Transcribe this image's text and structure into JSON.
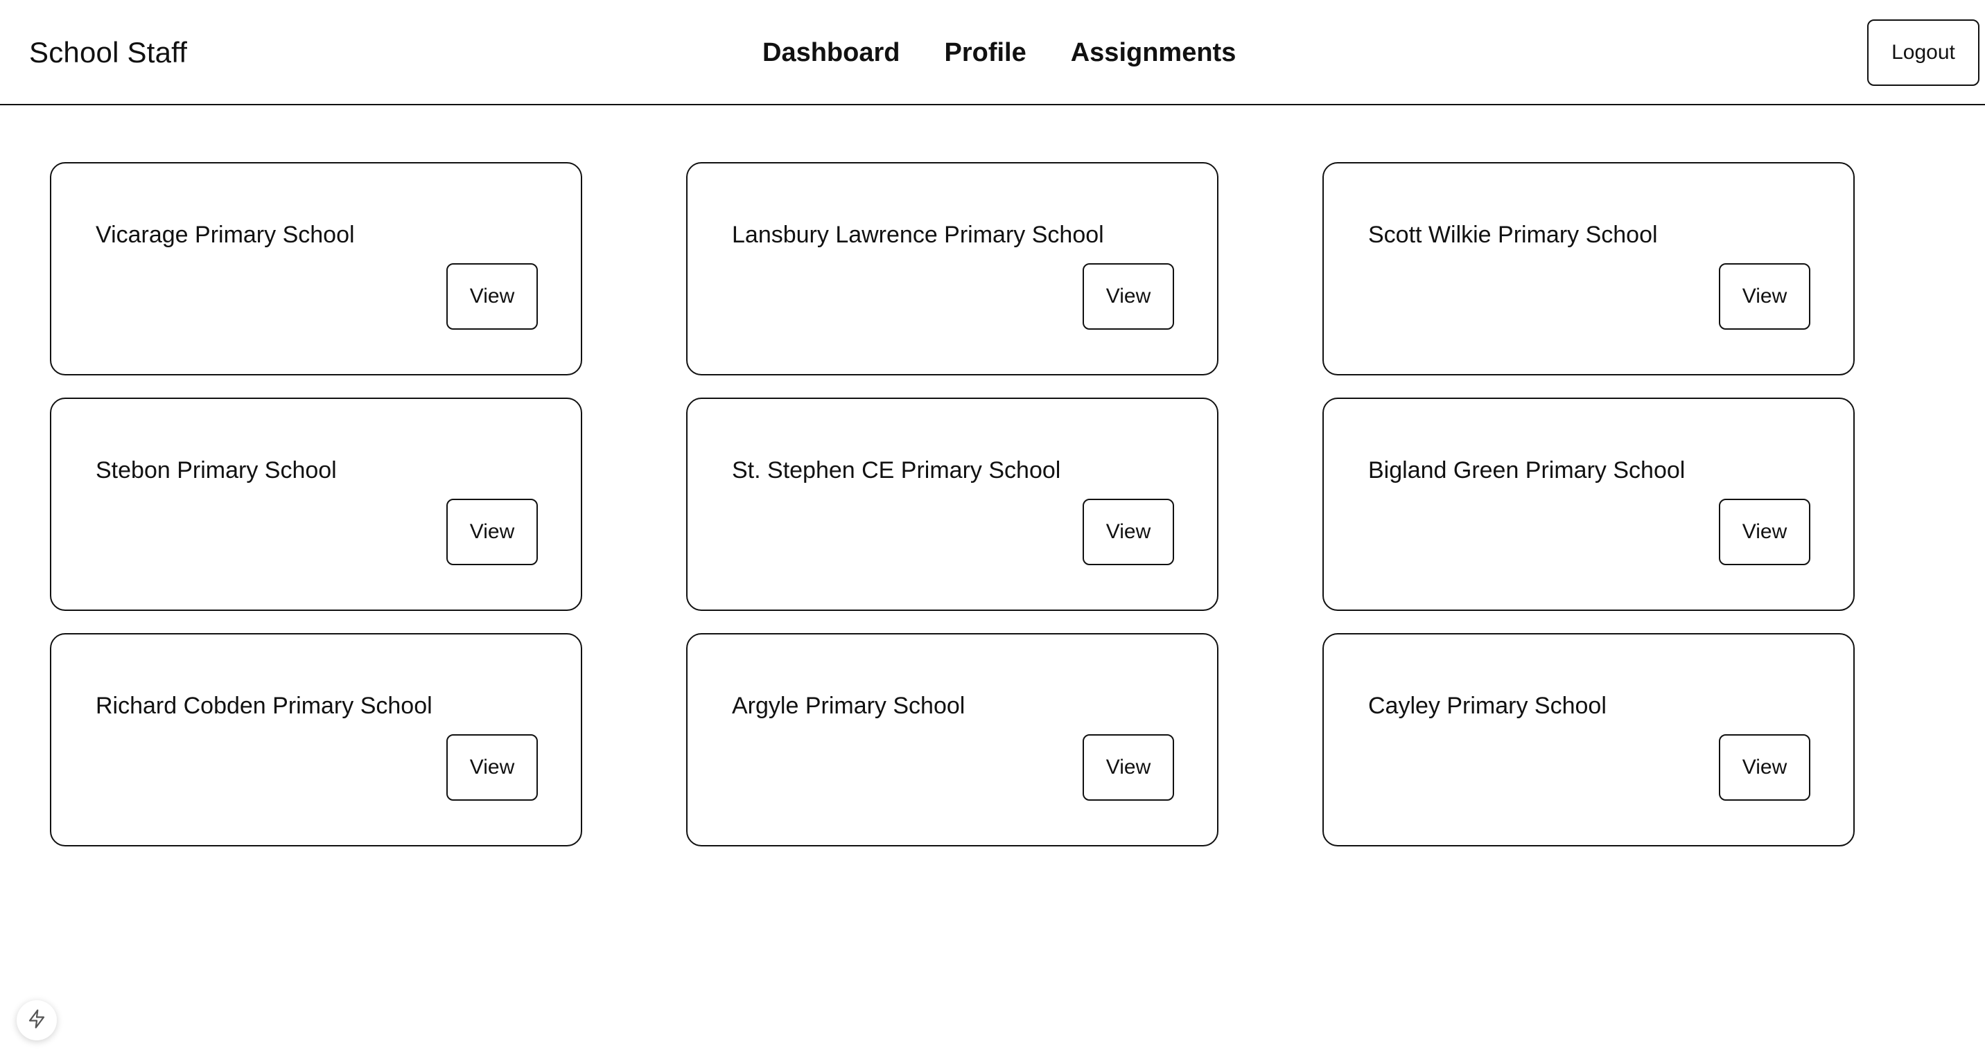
{
  "header": {
    "brand": "School Staff",
    "nav": [
      "Dashboard",
      "Profile",
      "Assignments"
    ],
    "logout_label": "Logout"
  },
  "cards": [
    {
      "title": "Vicarage Primary School",
      "button": "View"
    },
    {
      "title": "Lansbury Lawrence Primary School",
      "button": "View"
    },
    {
      "title": "Scott Wilkie Primary School",
      "button": "View"
    },
    {
      "title": "Stebon Primary School",
      "button": "View"
    },
    {
      "title": "St. Stephen CE Primary School",
      "button": "View"
    },
    {
      "title": "Bigland Green Primary School",
      "button": "View"
    },
    {
      "title": "Richard Cobden Primary School",
      "button": "View"
    },
    {
      "title": "Argyle Primary School",
      "button": "View"
    },
    {
      "title": "Cayley Primary School",
      "button": "View"
    }
  ],
  "floating_badge": {
    "icon": "lightning-bolt-icon"
  }
}
